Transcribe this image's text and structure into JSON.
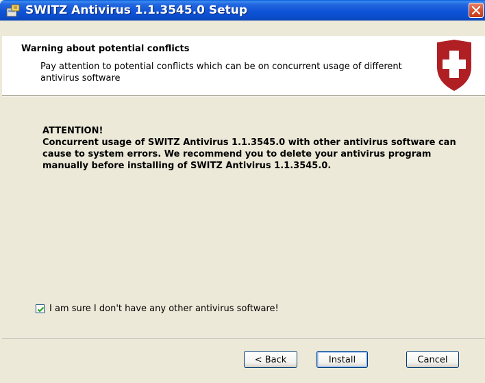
{
  "window": {
    "title": "SWITZ Antivirus 1.1.3545.0 Setup",
    "icons": {
      "app": "installer-icon",
      "close": "close-icon"
    }
  },
  "header": {
    "title": "Warning about potential conflicts",
    "description": "Pay attention to potential conflicts which can be on concurrent usage of different antivirus software",
    "logo": "shield-cross-icon",
    "colors": {
      "logo": "#b01f24"
    }
  },
  "body": {
    "attention_heading": "ATTENTION!",
    "attention_text": "Concurrent usage of SWITZ Antivirus 1.1.3545.0 with other antivirus software can cause to system errors. We recommend you to delete your antivirus program manually before installing of SWITZ Antivirus 1.1.3545.0."
  },
  "confirmation": {
    "label": "I am sure I don't have any other antivirus software!",
    "checked": true
  },
  "buttons": {
    "back": "< Back",
    "install": "Install",
    "cancel": "Cancel"
  },
  "colors": {
    "titlebar": "#0a4bc6",
    "dialog_background": "#ece9d8",
    "header_background": "#ffffff",
    "close_button": "#d9512d"
  }
}
